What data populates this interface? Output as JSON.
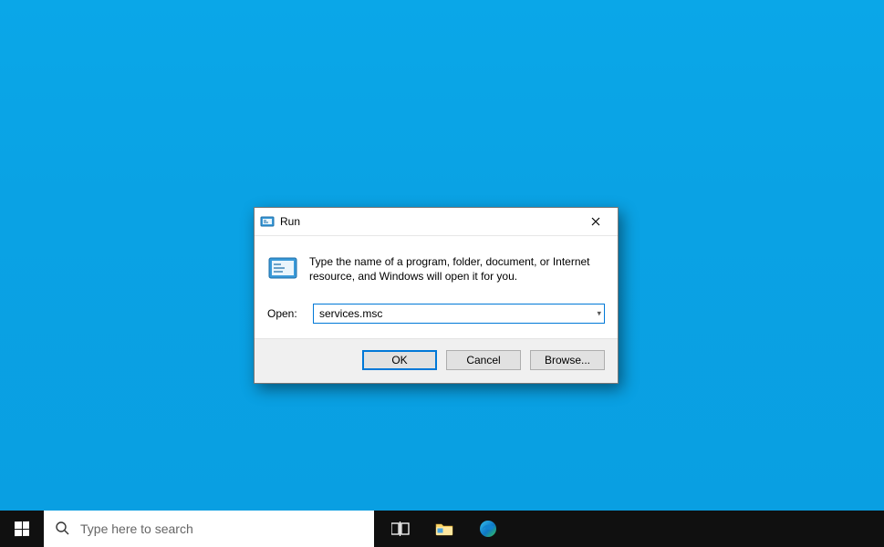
{
  "dialog": {
    "title": "Run",
    "description": "Type the name of a program, folder, document, or Internet resource, and Windows will open it for you.",
    "open_label": "Open:",
    "open_value": "services.msc",
    "buttons": {
      "ok": "OK",
      "cancel": "Cancel",
      "browse": "Browse..."
    }
  },
  "taskbar": {
    "search_placeholder": "Type here to search"
  }
}
